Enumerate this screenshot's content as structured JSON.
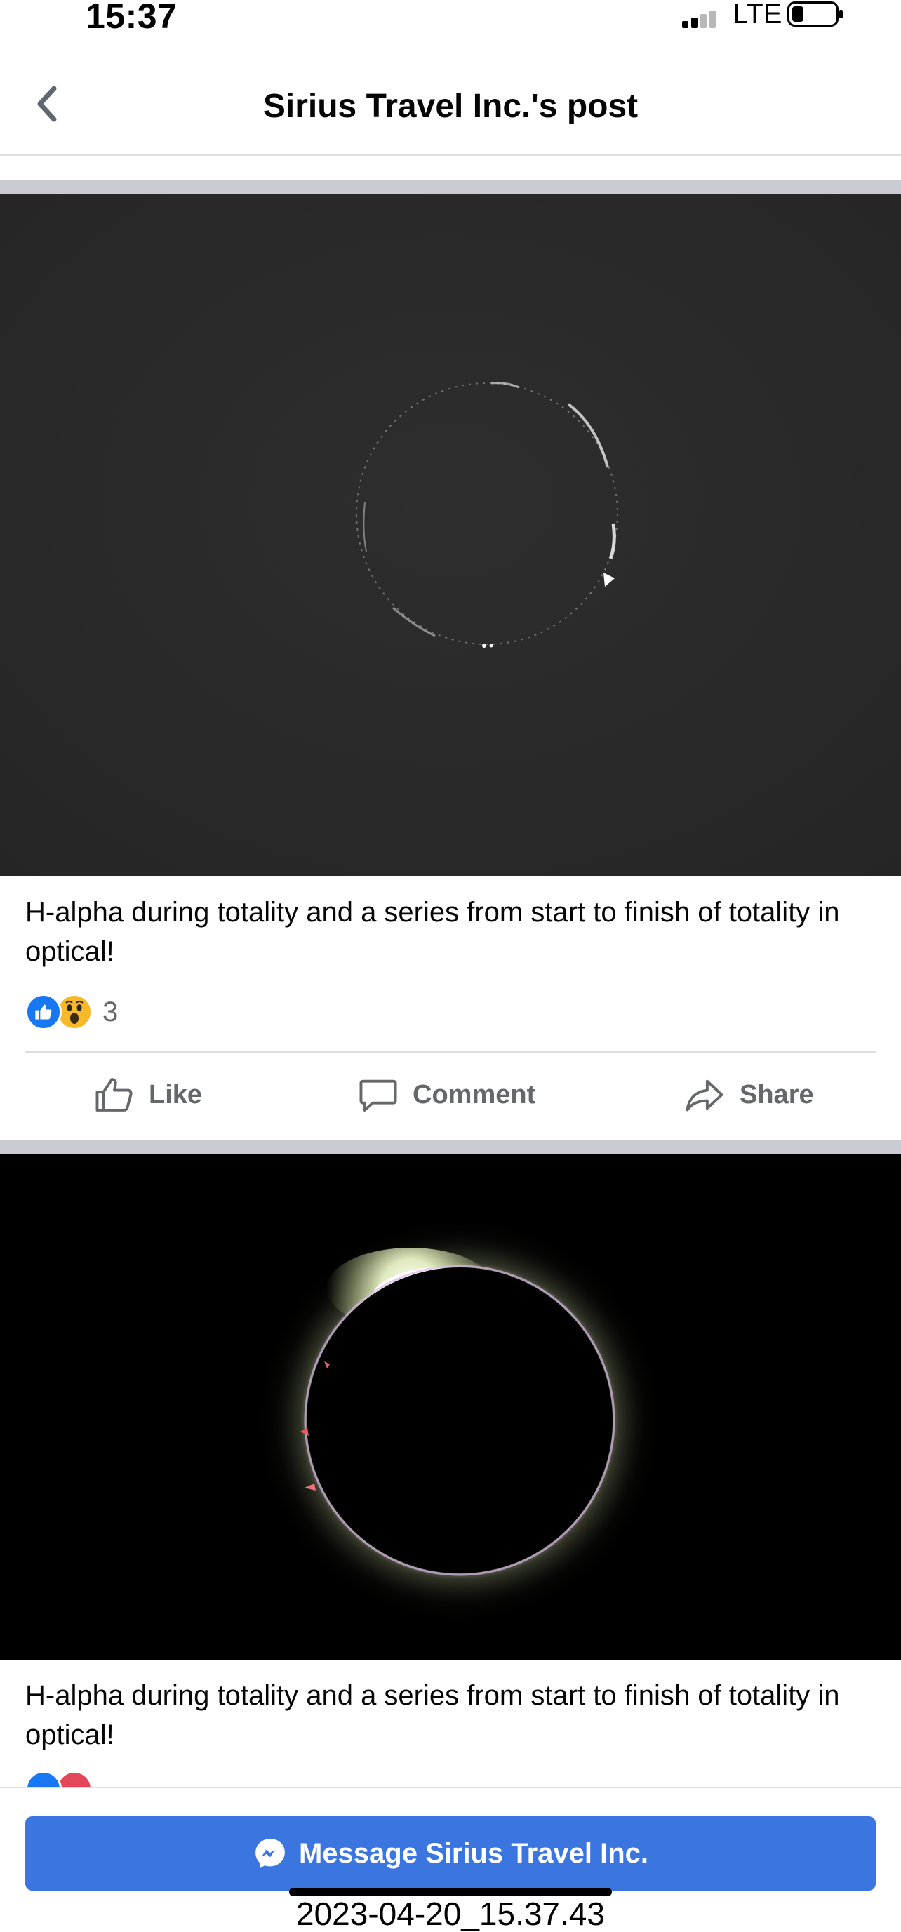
{
  "status_bar": {
    "time": "15:37",
    "network": "LTE"
  },
  "nav": {
    "title": "Sirius Travel Inc.'s post",
    "back_icon": "chevron-left-icon"
  },
  "posts": [
    {
      "caption": "H-alpha during totality and a series from start to finish of totality in optical!",
      "reaction_count": "3",
      "reaction_icons": [
        "like-icon",
        "wow-icon"
      ],
      "actions": {
        "like": "Like",
        "comment": "Comment",
        "share": "Share"
      }
    },
    {
      "caption": "H-alpha during totality and a series from start to finish of totality in optical!"
    }
  ],
  "bottom": {
    "message_button": "Message Sirius Travel Inc.",
    "screenshot_timestamp": "2023-04-20_15.37.43"
  },
  "colors": {
    "accent_blue": "#3a75e0",
    "like_blue": "#1877f2",
    "wow_yellow": "#f7b928",
    "secondary_text": "#65676b"
  }
}
